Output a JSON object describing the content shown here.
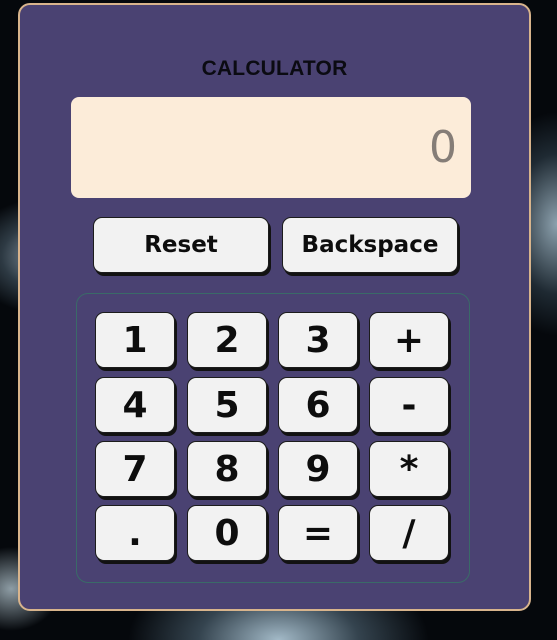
{
  "calculator": {
    "title": "CALCULATOR",
    "display": "0",
    "reset_label": "Reset",
    "backspace_label": "Backspace",
    "keys": [
      [
        "1",
        "2",
        "3",
        "+"
      ],
      [
        "4",
        "5",
        "6",
        "-"
      ],
      [
        "7",
        "8",
        "9",
        "*"
      ],
      [
        ".",
        "0",
        "=",
        "/"
      ]
    ]
  },
  "colors": {
    "panel": "#4a4272",
    "panel_border": "#d8b48c",
    "display_bg": "#fcecd9",
    "display_text": "#857d77",
    "button_bg": "#f2f2f2"
  }
}
